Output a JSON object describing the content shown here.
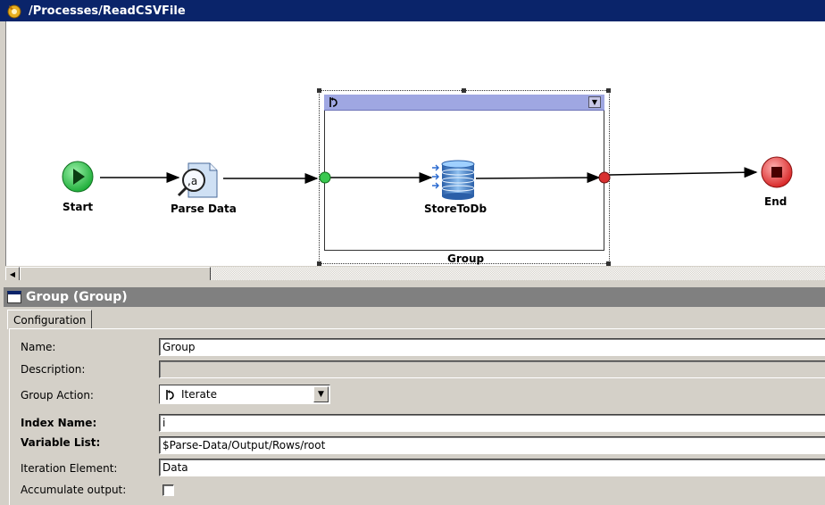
{
  "window": {
    "title": "/Processes/ReadCSVFile",
    "icon": "process-designer-icon"
  },
  "canvas": {
    "nodes": [
      {
        "id": "start",
        "label": "Start",
        "icon": "start-play-icon",
        "color": "#2fbf4a"
      },
      {
        "id": "parse",
        "label": "Parse Data",
        "icon": "parse-data-magnifier-icon"
      },
      {
        "id": "store",
        "label": "StoreToDb",
        "icon": "database-icon"
      },
      {
        "id": "end",
        "label": "End",
        "icon": "end-stop-icon",
        "color": "#e84848"
      }
    ],
    "group": {
      "label": "Group",
      "header_icon": "iterate-loop-icon",
      "header_color": "#9fa7e2"
    }
  },
  "panel": {
    "title": "Group (Group)",
    "tabs": [
      {
        "label": "Configuration"
      }
    ],
    "fields": {
      "name": {
        "label": "Name:",
        "value": "Group"
      },
      "description": {
        "label": "Description:",
        "value": ""
      },
      "group_action": {
        "label": "Group Action:",
        "value": "Iterate",
        "icon": "iterate-loop-icon"
      },
      "index_name": {
        "label": "Index Name:",
        "value": "i"
      },
      "variable_list": {
        "label": "Variable List:",
        "value": "$Parse-Data/Output/Rows/root"
      },
      "iteration_element": {
        "label": "Iteration Element:",
        "value": "Data"
      },
      "accumulate_output": {
        "label": "Accumulate output:",
        "checked": false
      }
    }
  }
}
